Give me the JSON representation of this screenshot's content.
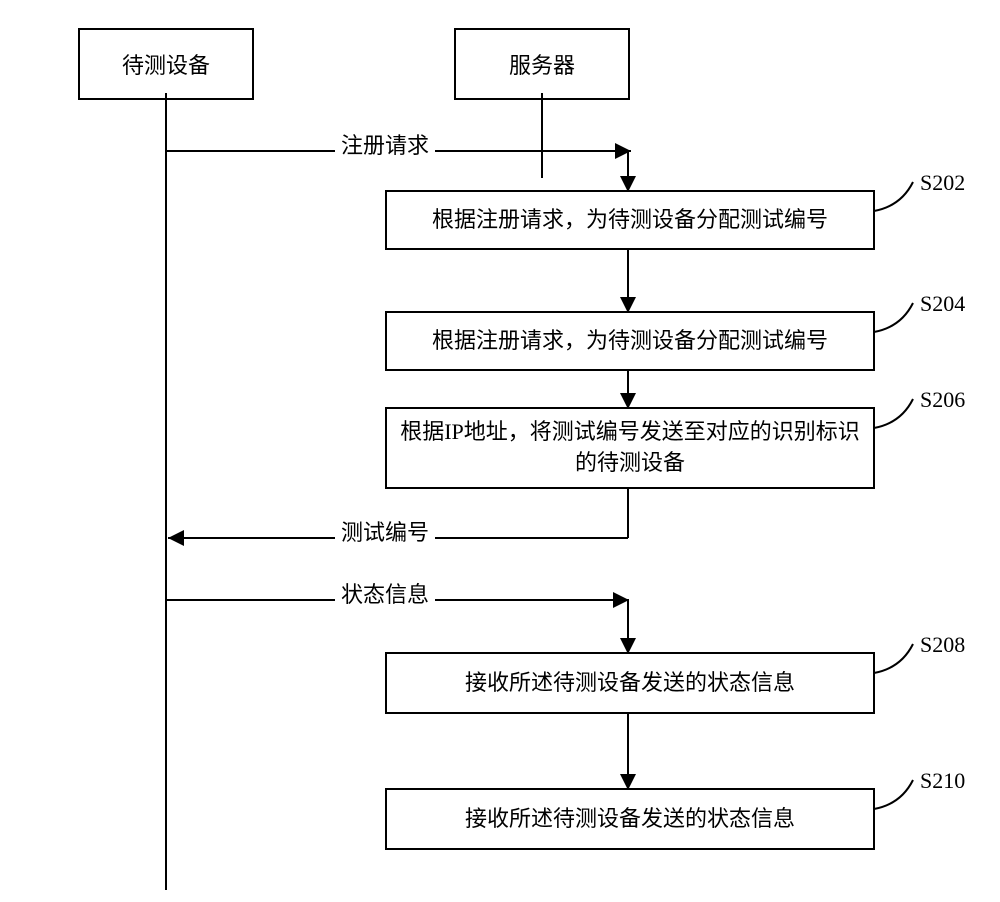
{
  "actors": {
    "dut": "待测设备",
    "server": "服务器"
  },
  "messages": {
    "register_request": "注册请求",
    "test_id": "测试编号",
    "status_info": "状态信息"
  },
  "steps": {
    "s202": {
      "id": "S202",
      "text": "根据注册请求，为待测设备分配测试编号"
    },
    "s204": {
      "id": "S204",
      "text": "根据注册请求，为待测设备分配测试编号"
    },
    "s206": {
      "id": "S206",
      "text": "根据IP地址，将测试编号发送至对应的识别标识的待测设备"
    },
    "s208": {
      "id": "S208",
      "text": "接收所述待测设备发送的状态信息"
    },
    "s210": {
      "id": "S210",
      "text": "接收所述待测设备发送的状态信息"
    }
  }
}
